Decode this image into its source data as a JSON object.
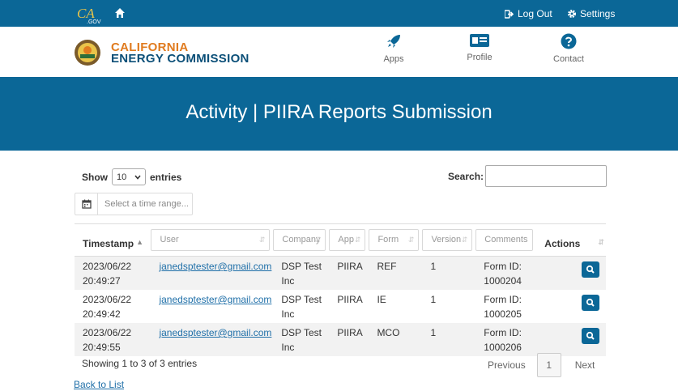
{
  "topbar": {
    "ca_logo_text": "CA",
    "ca_logo_sub": ".GOV",
    "logout_label": "Log Out",
    "settings_label": "Settings"
  },
  "header": {
    "org_line1": "CALIFORNIA",
    "org_line2": "ENERGY COMMISSION",
    "nav": [
      {
        "label": "Apps",
        "icon": "rocket-icon"
      },
      {
        "label": "Profile",
        "icon": "id-card-icon"
      },
      {
        "label": "Contact",
        "icon": "question-circle-icon"
      }
    ]
  },
  "banner": {
    "title": "Activity | PIIRA Reports Submission"
  },
  "controls": {
    "show_label": "Show",
    "entries_value": "10",
    "entries_label": "entries",
    "search_label": "Search:",
    "search_value": "",
    "date_range_placeholder": "Select a time range..."
  },
  "table": {
    "columns": {
      "timestamp": "Timestamp",
      "user": "User",
      "company": "Company",
      "app": "App",
      "form": "Form",
      "version": "Version",
      "comments": "Comments",
      "actions": "Actions"
    },
    "rows": [
      {
        "date": "2023/06/22",
        "time": "20:49:27",
        "user": "janedsptester@gmail.com",
        "company": "DSP Test Inc",
        "app": "PIIRA",
        "form": "REF",
        "version": "1",
        "comment1": "Form ID:",
        "comment2": "1000204"
      },
      {
        "date": "2023/06/22",
        "time": "20:49:42",
        "user": "janedsptester@gmail.com",
        "company": "DSP Test Inc",
        "app": "PIIRA",
        "form": "IE",
        "version": "1",
        "comment1": "Form ID:",
        "comment2": "1000205"
      },
      {
        "date": "2023/06/22",
        "time": "20:49:55",
        "user": "janedsptester@gmail.com",
        "company": "DSP Test Inc",
        "app": "PIIRA",
        "form": "MCO",
        "version": "1",
        "comment1": "Form ID:",
        "comment2": "1000206"
      }
    ]
  },
  "footer": {
    "info": "Showing 1 to 3 of 3 entries",
    "previous": "Previous",
    "page": "1",
    "next": "Next",
    "back_link": "Back to List"
  },
  "colors": {
    "brand_blue": "#0b6797",
    "orange": "#e07b1f",
    "navy": "#0b4f78"
  }
}
